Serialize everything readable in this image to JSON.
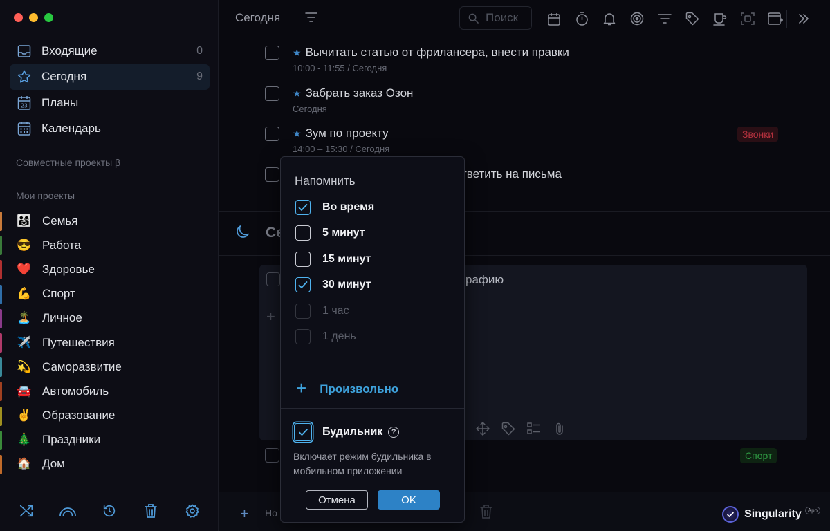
{
  "window": {
    "traffic_lights": [
      "#ff5f57",
      "#febc2e",
      "#28c840"
    ]
  },
  "sidebar": {
    "nav": [
      {
        "label": "Входящие",
        "count": "0",
        "icon": "inbox-icon"
      },
      {
        "label": "Сегодня",
        "count": "9",
        "icon": "star-icon",
        "active": true
      },
      {
        "label": "Планы",
        "count": "",
        "icon": "calendar-day-icon"
      },
      {
        "label": "Календарь",
        "count": "",
        "icon": "calendar-grid-icon"
      }
    ],
    "shared_title": "Совместные проекты β",
    "my_title": "Мои проекты",
    "projects": [
      {
        "label": "Семья",
        "emoji": "👨‍👩‍👧",
        "color": "#c87a3a"
      },
      {
        "label": "Работа",
        "emoji": "😎",
        "color": "#3a7a3a"
      },
      {
        "label": "Здоровье",
        "emoji": "❤️",
        "color": "#b03030"
      },
      {
        "label": "Спорт",
        "emoji": "💪",
        "color": "#2f6ea8"
      },
      {
        "label": "Личное",
        "emoji": "🏝️",
        "color": "#8a3a8a"
      },
      {
        "label": "Путешествия",
        "emoji": "✈️",
        "color": "#b03a6a"
      },
      {
        "label": "Саморазвитие",
        "emoji": "💫",
        "color": "#3a8a9a"
      },
      {
        "label": "Автомобиль",
        "emoji": "🚘",
        "color": "#a04020"
      },
      {
        "label": "Образование",
        "emoji": "✌️",
        "color": "#a09020"
      },
      {
        "label": "Праздники",
        "emoji": "🎄",
        "color": "#3a8a3a"
      },
      {
        "label": "Дом",
        "emoji": "🏠",
        "color": "#c06a2a"
      }
    ],
    "bottom_icons": [
      "shuffle-icon",
      "rainbow-icon",
      "history-icon",
      "trash-icon",
      "settings-icon"
    ]
  },
  "topbar": {
    "title": "Сегодня",
    "search_placeholder": "Поиск",
    "icons": [
      "calendar-icon",
      "timer-icon",
      "bell-icon",
      "focus-icon",
      "filter-icon",
      "tag-icon",
      "coffee-icon",
      "scan-icon",
      "new-window-icon"
    ]
  },
  "tasks": [
    {
      "title": "Вычитать статью от фрилансера, внести правки",
      "sub": "10:00 - 11:55 / Сегодня",
      "starred": true
    },
    {
      "title": "Забрать заказ Озон",
      "sub": "Сегодня",
      "starred": true
    },
    {
      "title": "Зум по проекту",
      "sub": "14:00 – 15:30 / Сегодня",
      "starred": true,
      "tag": "Звонки"
    },
    {
      "title": "тветить на письма",
      "sub": "",
      "starred": false
    }
  ],
  "evening": {
    "title": "Се"
  },
  "card": {
    "text": "рафию"
  },
  "bottom_task_tag": "Спорт",
  "bottombar": {
    "add_label": "Но"
  },
  "brand": {
    "name": "Singularity",
    "badge": "App"
  },
  "popover": {
    "heading": "Напомнить",
    "options": [
      {
        "label": "Во время",
        "checked": true,
        "disabled": false
      },
      {
        "label": "5 минут",
        "checked": false,
        "disabled": false
      },
      {
        "label": "15 минут",
        "checked": false,
        "disabled": false
      },
      {
        "label": "30 минут",
        "checked": true,
        "disabled": false
      },
      {
        "label": "1 час",
        "checked": false,
        "disabled": true
      },
      {
        "label": "1 день",
        "checked": false,
        "disabled": true
      }
    ],
    "custom_label": "Произвольно",
    "alarm_label": "Будильник",
    "alarm_checked": true,
    "alarm_help": "?",
    "alarm_note": "Включает режим будильника в мобильном приложении",
    "cancel_label": "Отмена",
    "ok_label": "OK"
  },
  "colors": {
    "accent": "#3ea2dc",
    "ok_button": "#2d82c6",
    "tag_red": "#b8323f",
    "tag_green": "#2f9a43"
  }
}
